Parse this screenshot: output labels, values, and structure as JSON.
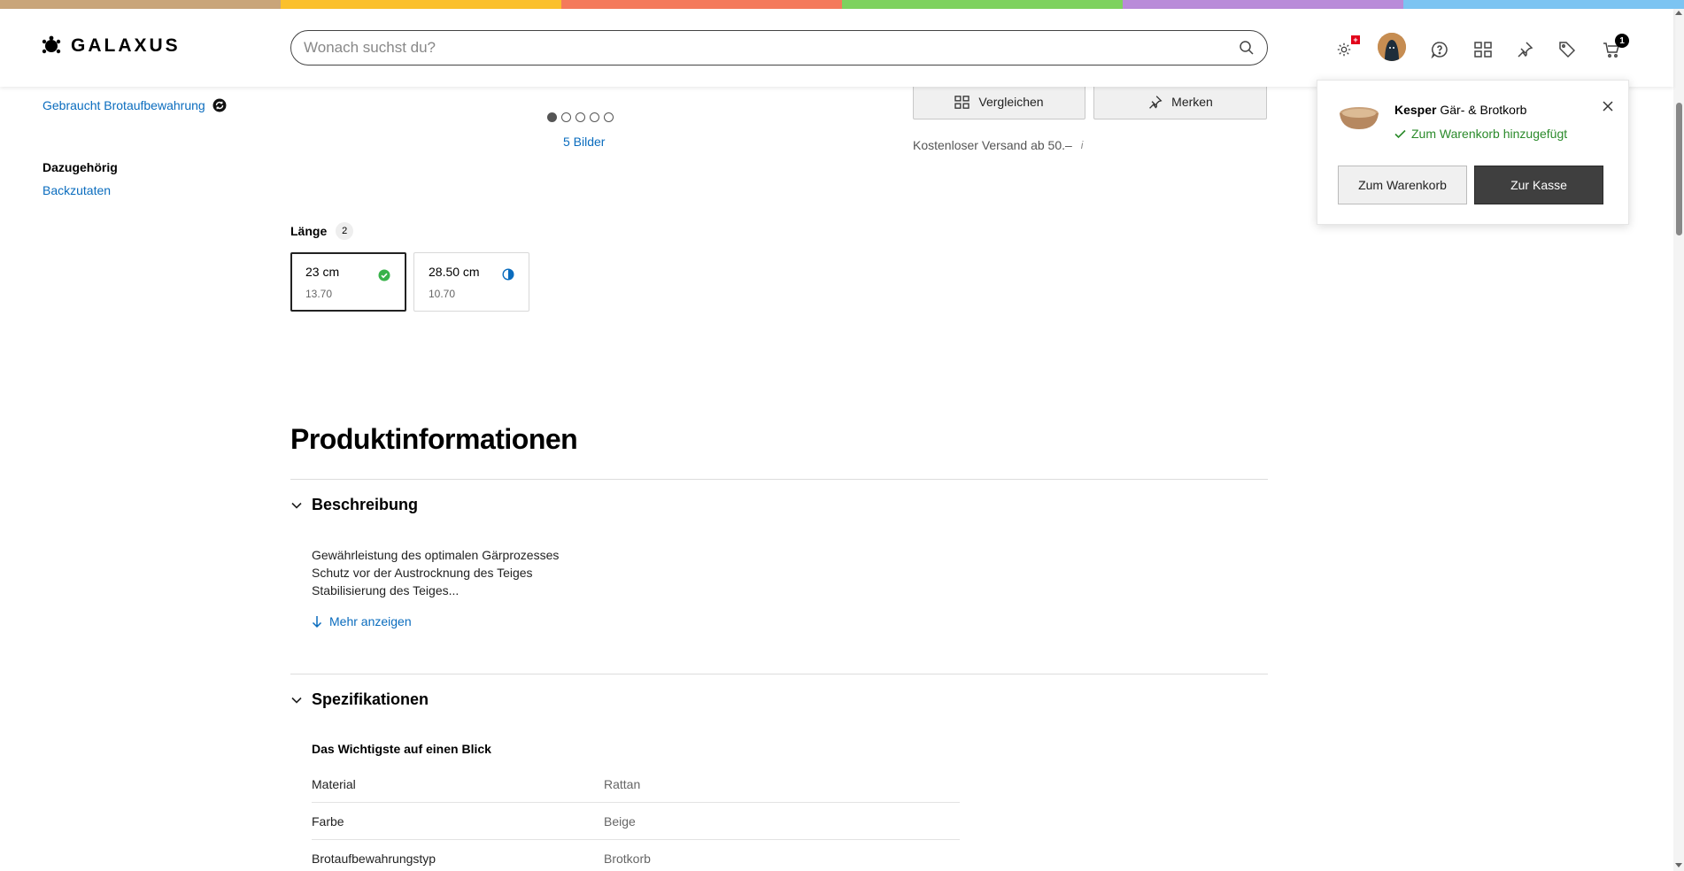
{
  "brand": {
    "name": "GALAXUS",
    "stripe_colors": [
      "#c9a57a",
      "#fbc02d",
      "#f47a5c",
      "#7ed25e",
      "#b98bd9",
      "#7cc4f2"
    ]
  },
  "search": {
    "placeholder": "Wonach suchst du?"
  },
  "header": {
    "cart_count": "1"
  },
  "sidebar": {
    "used_link": "Gebraucht Brotaufbewahrung",
    "related_heading": "Dazugehörig",
    "related_link": "Backzutaten"
  },
  "gallery": {
    "image_count_label": "5 Bilder",
    "dots": 5,
    "active_dot": 1
  },
  "actions": {
    "compare_label": "Vergleichen",
    "save_label": "Merken"
  },
  "shipping": {
    "text": "Kostenloser Versand ab 50.–",
    "info_icon": "i"
  },
  "variants": {
    "label": "Länge",
    "count": "2",
    "options": [
      {
        "size": "23 cm",
        "price": "13.70",
        "selected": true
      },
      {
        "size": "28.50 cm",
        "price": "10.70",
        "selected": false
      }
    ]
  },
  "product_info": {
    "title": "Produktinformationen",
    "description": {
      "heading": "Beschreibung",
      "lines": [
        "Gewährleistung des optimalen Gärprozesses",
        "Schutz vor der Austrocknung des Teiges",
        "Stabilisierung des Teiges..."
      ],
      "more_label": "Mehr anzeigen"
    },
    "specs": {
      "heading": "Spezifikationen",
      "subheading": "Das Wichtigste auf einen Blick",
      "rows": [
        {
          "key": "Material",
          "value": "Rattan"
        },
        {
          "key": "Farbe",
          "value": "Beige"
        },
        {
          "key": "Brotaufbewahrungstyp",
          "value": "Brotkorb"
        }
      ]
    }
  },
  "cart_popup": {
    "brand": "Kesper",
    "product": "Gär- & Brotkorb",
    "status": "Zum Warenkorb hinzugefügt",
    "cart_button": "Zum Warenkorb",
    "checkout_button": "Zur Kasse"
  }
}
